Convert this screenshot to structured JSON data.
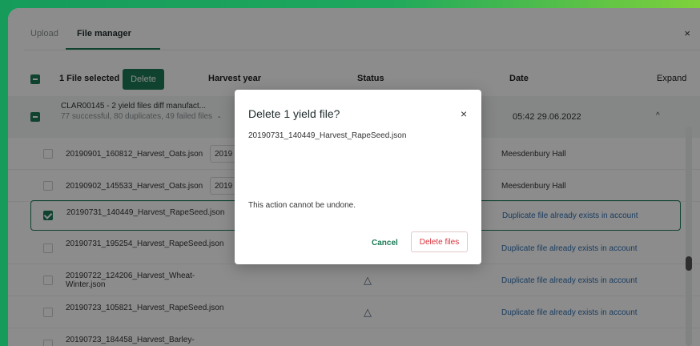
{
  "tabs": [
    {
      "label": "Upload"
    },
    {
      "label": "File manager"
    }
  ],
  "close_symbol": "×",
  "header": {
    "selected_text": "1 File selected",
    "delete_label": "Delete",
    "col_harvest_year": "Harvest year",
    "col_status": "Status",
    "col_date": "Date",
    "col_expand": "Expand"
  },
  "group": {
    "title": "CLAR00145 - 2 yield files diff manufact...",
    "subtitle": "77 successful, 80 duplicates, 49 failed files",
    "dash": "-",
    "date": "05:42 29.06.2022",
    "chevron": "^"
  },
  "rows": [
    {
      "name": "20190901_160812_Harvest_Oats.json",
      "year": "2019",
      "location": "Meesdenbury Hall"
    },
    {
      "name": "20190902_145533_Harvest_Oats.json",
      "year": "2019",
      "location": "Meesdenbury Hall"
    },
    {
      "name": "20190731_140449_Harvest_RapeSeed.json",
      "status_text": "Duplicate file already exists in account"
    },
    {
      "name": "20190731_195254_Harvest_RapeSeed.json",
      "status_text": "Duplicate file already exists in account"
    },
    {
      "name": "20190722_124206_Harvest_Wheat-Winter.json",
      "status_text": "Duplicate file already exists in account"
    },
    {
      "name": "20190723_105821_Harvest_RapeSeed.json",
      "status_text": "Duplicate file already exists in account"
    },
    {
      "name": "20190723_184458_Harvest_Barley-"
    }
  ],
  "modal": {
    "title": "Delete 1 yield file?",
    "close_symbol": "×",
    "filename": "20190731_140449_Harvest_RapeSeed.json",
    "warning": "This action cannot be undone.",
    "cancel_label": "Cancel",
    "delete_label": "Delete files"
  },
  "colors": {
    "accent": "#1c7a56",
    "danger": "#d8323c",
    "link": "#2f6fb1"
  }
}
